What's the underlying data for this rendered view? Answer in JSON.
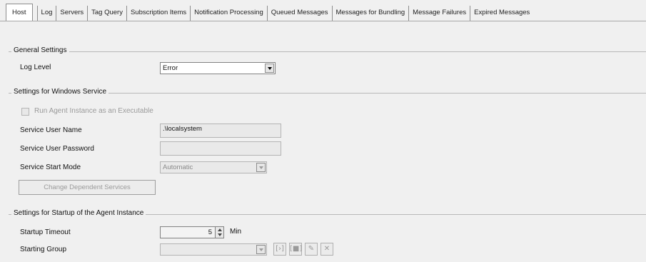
{
  "tabs": [
    {
      "label": "Host"
    },
    {
      "label": "Log"
    },
    {
      "label": "Servers"
    },
    {
      "label": "Tag Query"
    },
    {
      "label": "Subscription Items"
    },
    {
      "label": "Notification Processing"
    },
    {
      "label": "Queued Messages"
    },
    {
      "label": "Messages for Bundling"
    },
    {
      "label": "Message Failures"
    },
    {
      "label": "Expired Messages"
    }
  ],
  "general": {
    "title": "General Settings",
    "log_level_label": "Log Level",
    "log_level_value": "Error"
  },
  "service": {
    "title": "Settings for Windows Service",
    "run_as_exe_label": "Run Agent Instance as an Executable",
    "user_name_label": "Service User Name",
    "user_name_value": ".\\localsystem",
    "password_label": "Service User Password",
    "password_value": "",
    "start_mode_label": "Service Start Mode",
    "start_mode_value": "Automatic",
    "change_dependent_label": "Change Dependent Services"
  },
  "startup": {
    "title": "Settings for Startup of the Agent Instance",
    "timeout_label": "Startup Timeout",
    "timeout_value": "5",
    "timeout_unit": "Min",
    "group_label": "Starting Group",
    "group_value": "",
    "icons": [
      "start-icon",
      "stop-icon",
      "edit-icon",
      "delete-icon"
    ]
  }
}
